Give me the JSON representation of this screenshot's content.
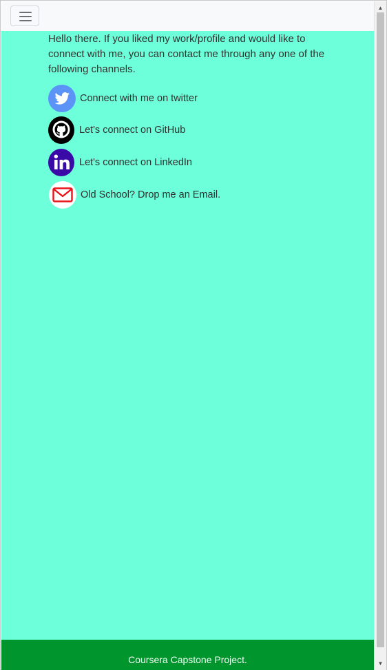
{
  "navbar": {
    "toggler_icon": "hamburger-menu-icon"
  },
  "main": {
    "intro": "Hello there. If you liked my work/profile and would like to connect with me, you can contact me through any one of the following channels.",
    "contacts": [
      {
        "label": "Connect with me on twitter",
        "icon": "twitter-icon"
      },
      {
        "label": "Let's connect on GitHub",
        "icon": "github-icon"
      },
      {
        "label": "Let's connect on LinkedIn",
        "icon": "linkedin-icon"
      },
      {
        "label": "Old School? Drop me an Email.",
        "icon": "email-icon"
      }
    ]
  },
  "footer": {
    "text": "Coursera Capstone Project."
  },
  "colors": {
    "navbar_bg": "#f8f9fb",
    "main_bg": "#6dffd9",
    "footer_bg": "#00962d",
    "twitter_blue": "#5b93f7",
    "github_black": "#000000",
    "linkedin_purple": "#3a0aa6",
    "email_red": "#e8131b"
  },
  "scrollbar": {
    "up_icon": "scroll-up-arrow-icon",
    "down_icon": "scroll-down-arrow-icon"
  }
}
